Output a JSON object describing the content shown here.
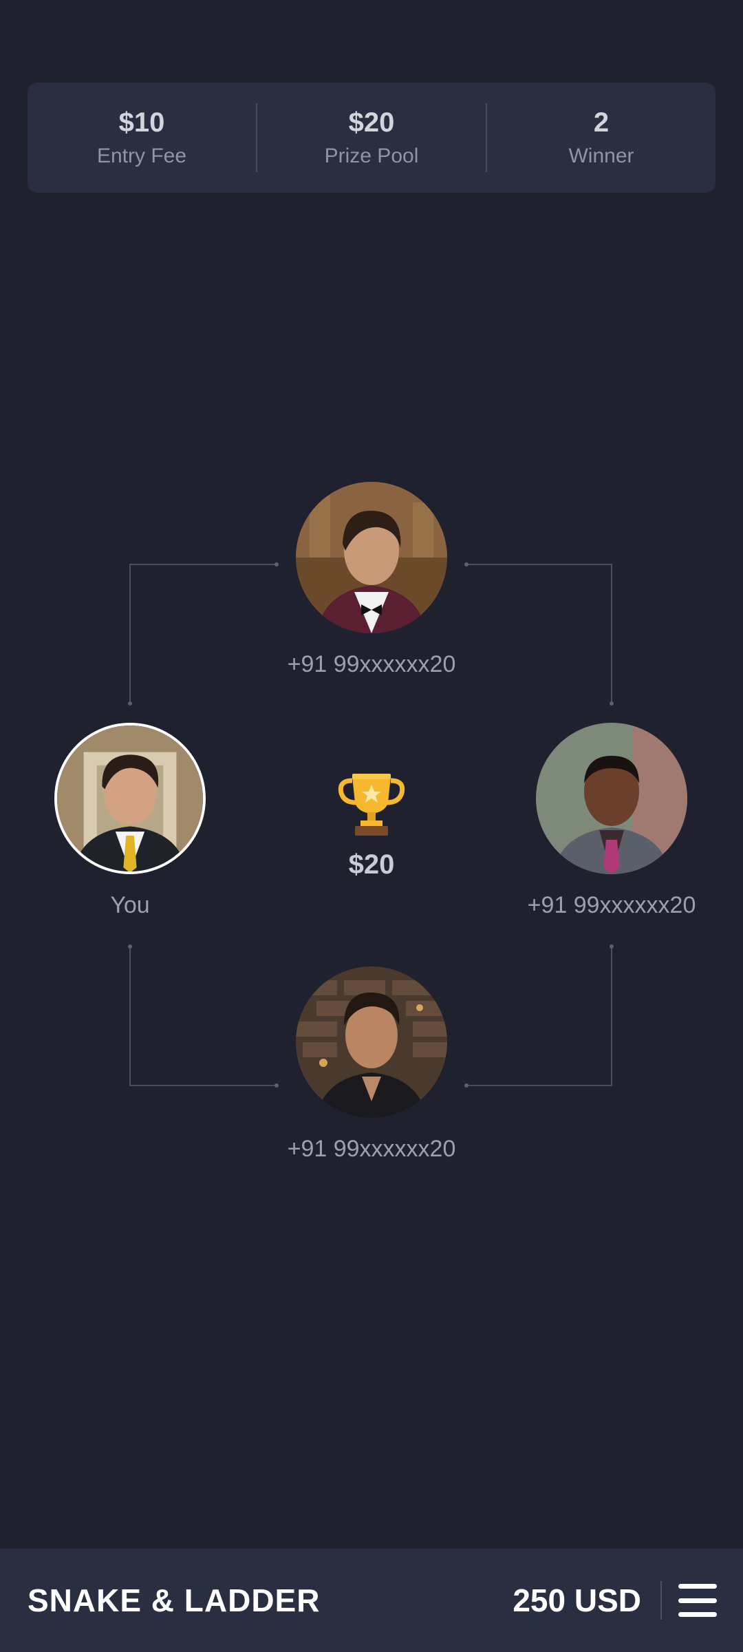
{
  "stats": {
    "entry_fee": {
      "value": "$10",
      "label": "Entry Fee"
    },
    "prize_pool": {
      "value": "$20",
      "label": "Prize Pool"
    },
    "winner": {
      "value": "2",
      "label": "Winner"
    }
  },
  "players": {
    "top": {
      "name": "+91 99xxxxxx20"
    },
    "left": {
      "name": "You"
    },
    "right": {
      "name": "+91 99xxxxxx20"
    },
    "bottom": {
      "name": "+91 99xxxxxx20"
    }
  },
  "prize": {
    "icon": "trophy-icon",
    "amount": "$20"
  },
  "bottom_bar": {
    "title": "SNAKE & LADDER",
    "balance": "250 USD",
    "menu_icon": "hamburger-menu-icon"
  },
  "colors": {
    "background": "#1f212e",
    "card": "#292f40",
    "trophy_gold": "#f5b82e"
  }
}
